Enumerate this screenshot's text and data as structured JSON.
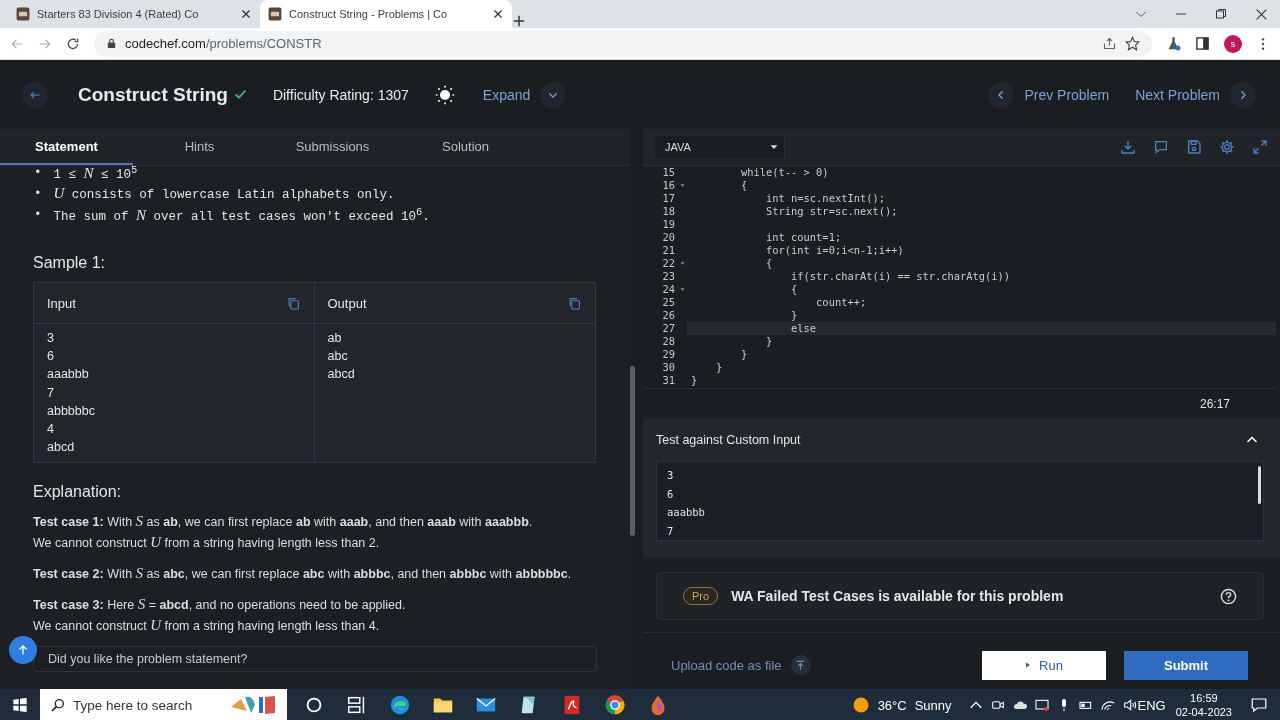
{
  "browser": {
    "tabs": [
      {
        "title": "Starters 83 Division 4 (Rated) Co",
        "selected": false
      },
      {
        "title": "Construct String - Problems | Co",
        "selected": true
      }
    ],
    "url_host": "codechef.com",
    "url_path": "/problems/CONSTR",
    "profile": "s"
  },
  "header": {
    "title": "Construct String",
    "solved": true,
    "difficulty": "Difficulty Rating: 1307",
    "expand": "Expand",
    "prev": "Prev Problem",
    "next": "Next Problem"
  },
  "tabs": [
    {
      "label": "Statement",
      "selected": true
    },
    {
      "label": "Hints",
      "selected": false
    },
    {
      "label": "Submissions",
      "selected": false
    },
    {
      "label": "Solution",
      "selected": false
    }
  ],
  "constraints": [
    {
      "bullet": "•",
      "text": "1 ≤ *N* ≤ 10$^{5}$"
    },
    {
      "bullet": "•",
      "text": "*U* consists of lowercase Latin alphabets only."
    },
    {
      "bullet": "•",
      "text": "The sum of *N* over all test cases won't exceed 10$^{6}$."
    }
  ],
  "sample": {
    "title": "Sample 1:",
    "input_label": "Input",
    "output_label": "Output",
    "input": [
      "3",
      "6",
      "aaabbb",
      "7",
      "abbbbbc",
      "4",
      "abcd"
    ],
    "output": [
      "ab",
      "abc",
      "abcd"
    ]
  },
  "explanation": {
    "title": "Explanation:",
    "paragraphs": [
      [
        "**Test case 1:** With *S* as **ab**, we can first replace **ab** with **aaab**, and then **aaab** with **aaabbb**.",
        "We cannot construct *U* from a string having length less than 2."
      ],
      [
        "**Test case 2:** With *S* as **abc**, we can first replace **abc** with **abbbc**, and then **abbbc** with **abbbbbc**."
      ],
      [
        "**Test case 3:** Here *S* = **abcd**, and no operations need to be applied.",
        "We cannot construct *U* from a string having length less than 4."
      ]
    ]
  },
  "feedback": "Did you like the problem statement?",
  "editor": {
    "language": "JAVA",
    "cursor": "26:17",
    "lines": [
      {
        "number": "15",
        "code": "        while(t-- > 0)",
        "fold": false,
        "current": false
      },
      {
        "number": "16",
        "code": "        {",
        "fold": true,
        "current": false
      },
      {
        "number": "17",
        "code": "            int n=sc.nextInt();",
        "fold": false,
        "current": false
      },
      {
        "number": "18",
        "code": "            String str=sc.next();",
        "fold": false,
        "current": false
      },
      {
        "number": "19",
        "fold": false,
        "current": false
      },
      {
        "number": "20",
        "code": "            int count=1;",
        "fold": false,
        "current": false
      },
      {
        "number": "21",
        "code": "            for(int i=0;i<n-1;i++)",
        "fold": false,
        "current": false
      },
      {
        "number": "22",
        "code": "            {",
        "fold": true,
        "current": false
      },
      {
        "number": "23",
        "code": "                if(str.charAt(i) == str.charAtg(i))",
        "fold": false,
        "current": false
      },
      {
        "number": "24",
        "code": "                {",
        "fold": true,
        "current": false
      },
      {
        "number": "25",
        "code": "                    count++;",
        "fold": false,
        "current": false
      },
      {
        "number": "26",
        "code": "                }",
        "fold": false,
        "current": false
      },
      {
        "number": "27",
        "code": "                else",
        "fold": false,
        "current": true
      },
      {
        "number": "28",
        "code": "            }",
        "fold": false,
        "current": false
      },
      {
        "number": "29",
        "code": "        }",
        "fold": false,
        "current": false
      },
      {
        "number": "30",
        "code": "    }",
        "fold": false,
        "current": false
      },
      {
        "number": "31",
        "code": "}",
        "fold": false,
        "current": false
      }
    ]
  },
  "custom_input": {
    "title": "Test against Custom Input",
    "expanded": true,
    "lines": [
      "3",
      "6",
      "aaabbb",
      "7"
    ]
  },
  "pro": {
    "badge": "Pro",
    "message": "WA Failed Test Cases is available for this problem"
  },
  "actions": {
    "upload": "Upload code as file",
    "run": "Run",
    "submit": "Submit"
  },
  "taskbar": {
    "search_placeholder": "Type here to search",
    "temperature": "36°C",
    "weather": "Sunny",
    "language": "ENG",
    "time": "16:59",
    "date": "02-04-2023"
  }
}
